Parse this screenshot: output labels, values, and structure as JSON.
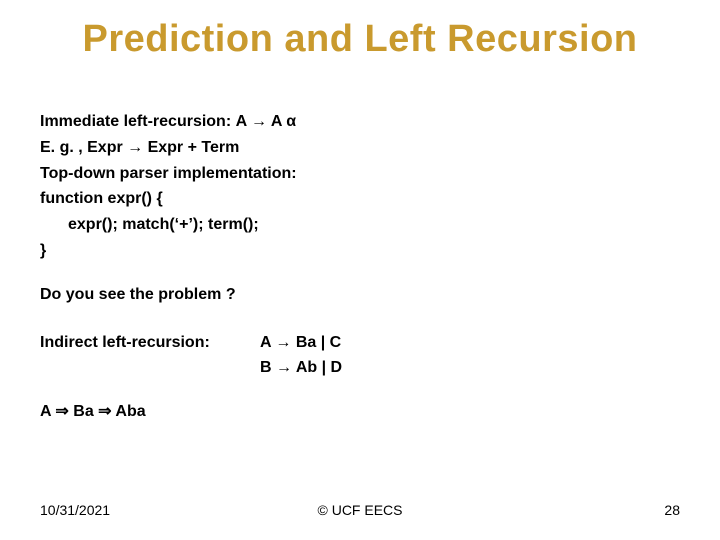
{
  "title": "Prediction and Left Recursion",
  "line1_pre": "Immediate left-recursion: ",
  "line1_rule": "A → A α",
  "line2": "E. g. ,  Expr → Expr + Term",
  "line3": "Top-down parser implementation:",
  "line4": "function expr() {",
  "line5": "expr(); match(‘+’); term();",
  "line6": "}",
  "question": "Do you see the problem ?",
  "indirect_label": "Indirect left-recursion:",
  "ruleA": "A → Ba  |  C",
  "ruleB": "B → Ab  |  D",
  "deriv": "A ⇒ Ba ⇒ Aba",
  "footer": {
    "date": "10/31/2021",
    "center": "© UCF EECS",
    "page": "28"
  }
}
